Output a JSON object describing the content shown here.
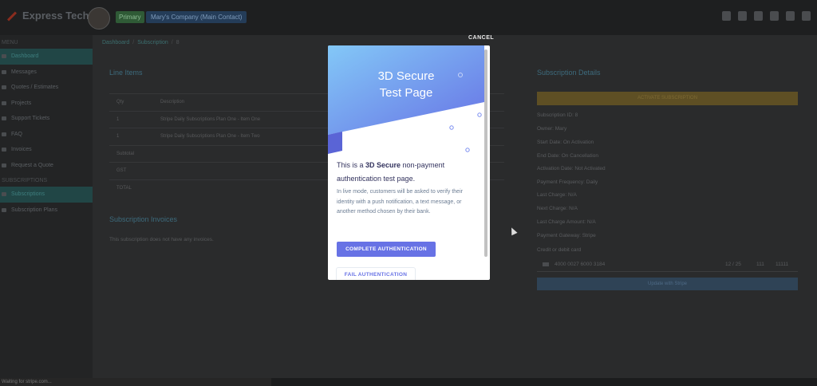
{
  "app": {
    "brand": "Express Tech",
    "primary_tag": "Primary",
    "company_tag": "Mary's Company (Main Contact)",
    "status_bar": "Waiting for stripe.com..."
  },
  "topbar_icons": [
    "bell-icon",
    "envelope-icon",
    "sliders-icon",
    "document-icon",
    "users-icon",
    "sign-out-icon"
  ],
  "sidebar": {
    "menu_heading": "MENU",
    "items": [
      {
        "label": "Dashboard",
        "icon": "dashboard-icon",
        "active": true
      },
      {
        "label": "Messages",
        "icon": "envelope-icon",
        "active": false
      },
      {
        "label": "Quotes / Estimates",
        "icon": "quote-icon",
        "active": false
      },
      {
        "label": "Projects",
        "icon": "folder-icon",
        "active": false
      },
      {
        "label": "Support Tickets",
        "icon": "ticket-icon",
        "active": false
      },
      {
        "label": "FAQ",
        "icon": "question-icon",
        "active": false
      },
      {
        "label": "Invoices",
        "icon": "invoice-icon",
        "active": false
      },
      {
        "label": "Request a Quote",
        "icon": "plus-icon",
        "active": false
      }
    ],
    "subs_heading": "SUBSCRIPTIONS",
    "sub_items": [
      {
        "label": "Subscriptions",
        "icon": "refresh-icon",
        "active": true
      },
      {
        "label": "Subscription Plans",
        "icon": "calendar-icon",
        "active": false
      }
    ]
  },
  "breadcrumb": {
    "first": "Dashboard",
    "second": "Subscription",
    "last": "8"
  },
  "line_items": {
    "title": "Line Items",
    "col_qty": "Qty",
    "col_desc": "Description",
    "rows": [
      {
        "qty": "1",
        "desc": "Stripe Daily Subscriptions Plan One - Item One"
      },
      {
        "qty": "1",
        "desc": "Stripe Daily Subscriptions Plan One - Item Two"
      }
    ],
    "subtotal": "Subtotal",
    "gst": "GST",
    "total": "TOTAL"
  },
  "invoices": {
    "title": "Subscription Invoices",
    "empty": "This subscription does not have any invoices."
  },
  "details": {
    "title": "Subscription Details",
    "activate_label": "ACTIVATE SUBSCRIPTION",
    "lines": [
      "Subscription ID: 8",
      "Owner: Mary",
      "Start Date: On Activation",
      "End Date: On Cancellation",
      "Activation Date: Not Activated",
      "Payment Frequency: Daily",
      "Last Charge: N/A",
      "Next Charge: N/A",
      "Last Charge Amount: N/A",
      "Payment Gateway: Stripe"
    ],
    "card_label": "Credit or debit card",
    "card_number": "4000 0027 6000 3184",
    "card_exp": "12 / 25",
    "card_cvc": "111",
    "card_zip": "11111",
    "update_label": "Update with Stripe"
  },
  "modal": {
    "cancel": "CANCEL",
    "title_line1": "3D Secure",
    "title_line2": "Test Page",
    "lead_1": "This is a ",
    "lead_bold": "3D Secure",
    "lead_2": " non-payment authentication test page.",
    "description": "In live mode, customers will be asked to verify their identity with a push notification, a text message, or another method chosen by their bank.",
    "complete_label": "COMPLETE AUTHENTICATION",
    "fail_label": "FAIL AUTHENTICATION",
    "header_gradient": [
      "#83c8f7",
      "#6772e5"
    ]
  }
}
